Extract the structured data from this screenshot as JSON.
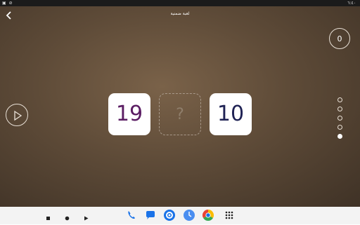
{
  "status_bar": {
    "left_icons": "▣ ⊘",
    "right_text": "٦:٤٠"
  },
  "header": {
    "title": "لعبة ضمنية"
  },
  "score": "0",
  "cards": {
    "left": "19",
    "middle": "?",
    "right": "10"
  },
  "progress": {
    "total": 5,
    "active_index": 4
  },
  "colors": {
    "left_number": "#5b1d63",
    "right_number": "#1f2254",
    "background_center": "#7a6249"
  },
  "dock_icons": [
    "phone-icon",
    "messages-icon",
    "settings-icon",
    "clock-icon",
    "chrome-icon",
    "app-grid-icon"
  ],
  "nav_buttons": [
    "stop",
    "home",
    "back"
  ]
}
